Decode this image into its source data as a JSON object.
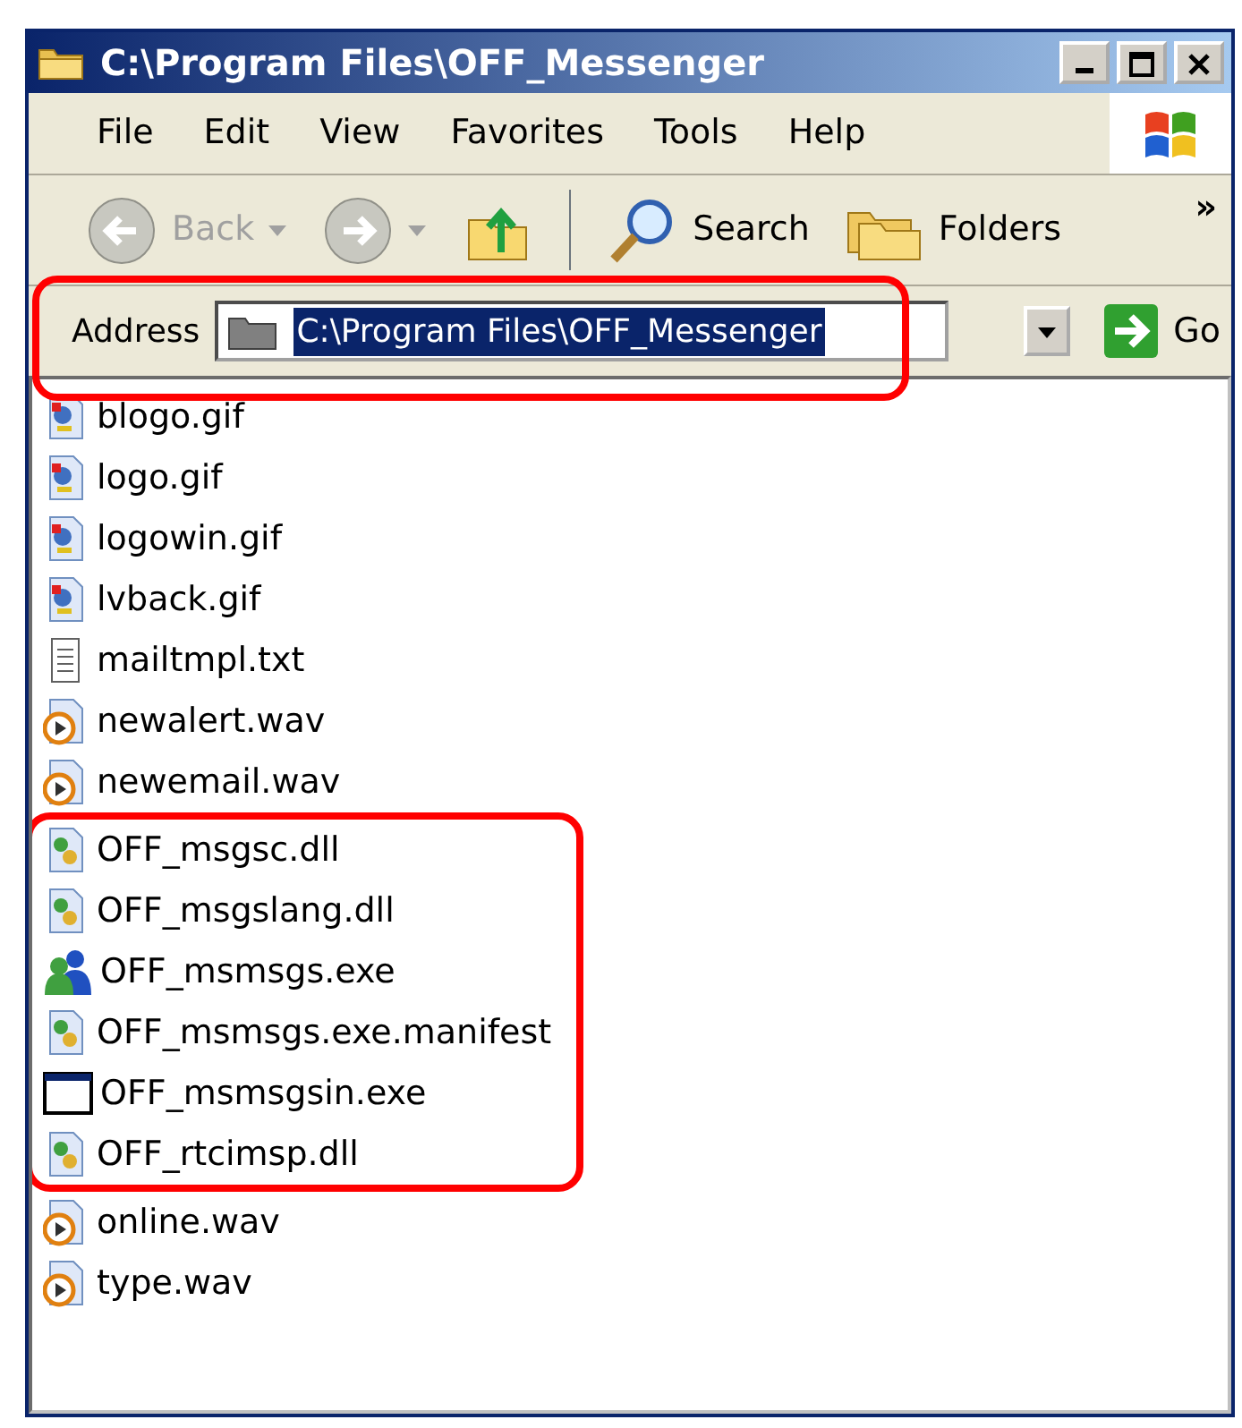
{
  "window": {
    "title": "C:\\Program Files\\OFF_Messenger"
  },
  "menu": [
    "File",
    "Edit",
    "View",
    "Favorites",
    "Tools",
    "Help"
  ],
  "toolbar": [
    {
      "kind": "back",
      "label": "Back",
      "disabled": true
    },
    {
      "kind": "forward",
      "disabled": true
    },
    {
      "kind": "up",
      "disabled": false
    },
    {
      "kind": "search",
      "label": "Search",
      "disabled": false
    },
    {
      "kind": "folders",
      "label": "Folders",
      "disabled": false
    }
  ],
  "toolbar_more": "»",
  "address_bar": {
    "label": "Address",
    "value": "C:\\Program Files\\OFF_Messenger",
    "go": "Go",
    "highlighted": true
  },
  "files": [
    {
      "name": "blogo.gif",
      "kind": "image",
      "highlighted": false
    },
    {
      "name": "logo.gif",
      "kind": "image",
      "highlighted": false
    },
    {
      "name": "logowin.gif",
      "kind": "image",
      "highlighted": false
    },
    {
      "name": "lvback.gif",
      "kind": "image",
      "highlighted": false
    },
    {
      "name": "mailtmpl.txt",
      "kind": "text",
      "highlighted": false
    },
    {
      "name": "newalert.wav",
      "kind": "sound",
      "highlighted": false
    },
    {
      "name": "newemail.wav",
      "kind": "sound",
      "highlighted": false
    },
    {
      "name": "OFF_msgsc.dll",
      "kind": "library",
      "highlighted": true
    },
    {
      "name": "OFF_msgslang.dll",
      "kind": "library",
      "highlighted": true
    },
    {
      "name": "OFF_msmsgs.exe",
      "kind": "messenger",
      "highlighted": true
    },
    {
      "name": "OFF_msmsgs.exe.manifest",
      "kind": "library",
      "highlighted": true
    },
    {
      "name": "OFF_msmsgsin.exe",
      "kind": "program",
      "highlighted": true
    },
    {
      "name": "OFF_rtcimsp.dll",
      "kind": "library",
      "highlighted": true
    },
    {
      "name": "online.wav",
      "kind": "sound",
      "highlighted": false
    },
    {
      "name": "type.wav",
      "kind": "sound",
      "highlighted": false
    }
  ]
}
